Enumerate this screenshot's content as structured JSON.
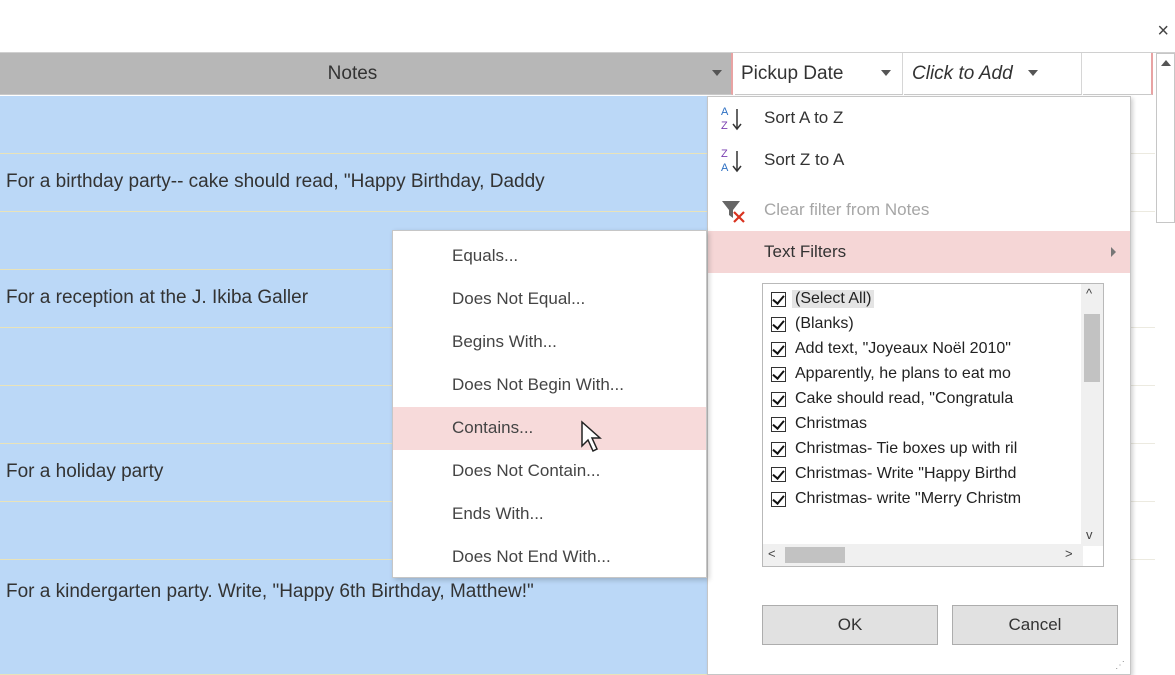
{
  "window": {
    "close_glyph": "×"
  },
  "columns": {
    "notes": "Notes",
    "pickup_date": "Pickup Date",
    "click_to_add": "Click to Add"
  },
  "rows": [
    "",
    "For a birthday party-- cake should read, \"Happy Birthday, Daddy",
    "",
    "For a reception at the J. Ikiba Galler",
    "",
    "",
    "For a holiday party",
    "",
    "For a kindergarten party. Write, \"Happy 6th Birthday, Matthew!\""
  ],
  "filter_menu": {
    "sort_asc": "Sort A to Z",
    "sort_desc": "Sort Z to A",
    "clear_filter": "Clear filter from Notes",
    "text_filters": "Text Filters",
    "list_items": [
      "(Select All)",
      "(Blanks)",
      "Add text, \"Joyeaux Noël 2010\"",
      "Apparently, he plans to eat mo",
      "Cake should read, \"Congratula",
      "Christmas",
      "Christmas- Tie boxes up with ril",
      "Christmas- Write \"Happy Birthd",
      "Christmas- write \"Merry Christm"
    ],
    "ok": "OK",
    "cancel": "Cancel"
  },
  "text_filters_submenu": [
    "Equals...",
    "Does Not Equal...",
    "Begins With...",
    "Does Not Begin With...",
    "Contains...",
    "Does Not Contain...",
    "Ends With...",
    "Does Not End With..."
  ],
  "colors": {
    "grid_bg": "#bbd8f7",
    "highlight": "#f5d6d6",
    "header_bg": "#b7b7b7"
  }
}
